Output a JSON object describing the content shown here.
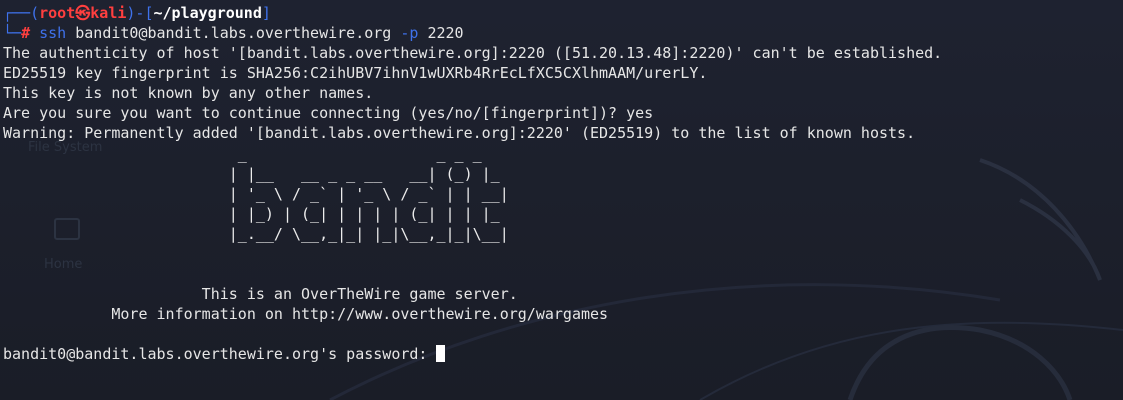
{
  "prompt": {
    "corner_top": "┌──(",
    "user": "root",
    "skull_icon": "㉿",
    "host": "kali",
    "mid": ")-[",
    "cwd": "~/playground",
    "close": "]",
    "corner_bottom": "└─",
    "hash": "#"
  },
  "command": {
    "program": "ssh",
    "args": "bandit0@bandit.labs.overthewire.org",
    "flag": "-p",
    "port": "2220"
  },
  "output_lines": [
    "The authenticity of host '[bandit.labs.overthewire.org]:2220 ([51.20.13.48]:2220)' can't be established.",
    "ED25519 key fingerprint is SHA256:C2ihUBV7ihnV1wUXRb4RrEcLfXC5CXlhmAAM/urerLY.",
    "This key is not known by any other names.",
    "Are you sure you want to continue connecting (yes/no/[fingerprint])? yes",
    "Warning: Permanently added '[bandit.labs.overthewire.org]:2220' (ED25519) to the list of known hosts."
  ],
  "banner_ascii": [
    "                          _                     _ _ _",
    "                         | |__   __ _ _ __   __| (_) |_",
    "                         | '_ \\ / _` | '_ \\ / _` | | __|",
    "                         | |_) | (_| | | | | (_| | | |_",
    "                         |_.__/ \\__,_|_| |_|\\__,_|_|\\__|"
  ],
  "motd": {
    "line1": "                      This is an OverTheWire game server.",
    "line2": "            More information on http://www.overthewire.org/wargames"
  },
  "password_prompt": "bandit0@bandit.labs.overthewire.org's password: ",
  "background": {
    "ghost_labels": [
      "File System",
      "Home"
    ]
  },
  "colors": {
    "background": "#1b1e28",
    "prompt_blue": "#3f72ec",
    "prompt_red": "#ff3f3f",
    "text": "#e6e6e6"
  }
}
